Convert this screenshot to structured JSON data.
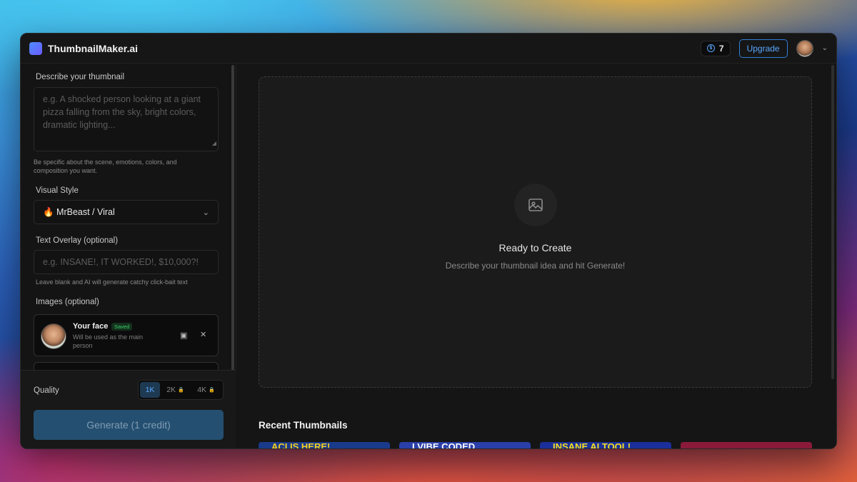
{
  "app": {
    "brand": "ThumbnailMaker.ai",
    "credits": "7",
    "upgrade_label": "Upgrade"
  },
  "form": {
    "describe_label": "Describe your thumbnail",
    "describe_placeholder": "e.g. A shocked person looking at a giant pizza falling from the sky, bright colors, dramatic lighting...",
    "describe_hint": "Be specific about the scene, emotions, colors, and composition you want.",
    "style_label": "Visual Style",
    "style_value": "🔥 MrBeast / Viral",
    "overlay_label": "Text Overlay (optional)",
    "overlay_placeholder": "e.g. INSANE!, IT WORKED!, $10,000?!",
    "overlay_hint": "Leave blank and AI will generate catchy click-bait text",
    "images_label": "Images (optional)",
    "face_card": {
      "title": "Your face",
      "badge": "Saved",
      "desc": "Will be used as the main person"
    }
  },
  "quality": {
    "label": "Quality",
    "options": [
      "1K",
      "2K",
      "4K"
    ],
    "selected": "1K"
  },
  "generate_label": "Generate (1 credit)",
  "canvas": {
    "title": "Ready to Create",
    "subtitle": "Describe your thumbnail idea and hit Generate!"
  },
  "recent": {
    "title": "Recent Thumbnails",
    "items": [
      {
        "text": "ACI IS HERE!",
        "bg": "#1a3a8a",
        "color": "#f5d020"
      },
      {
        "text": "I VIBE CODED",
        "bg": "#2a3fa8",
        "color": "#ffffff"
      },
      {
        "text": "INSANE AI TOOL!",
        "bg": "#1b2f9a",
        "color": "#f5e020"
      },
      {
        "text": "",
        "bg": "#8a1a3a",
        "color": "#ffffff"
      }
    ]
  },
  "colors": {
    "accent": "#5aa7ff",
    "saved_green": "#3fcf6a"
  }
}
